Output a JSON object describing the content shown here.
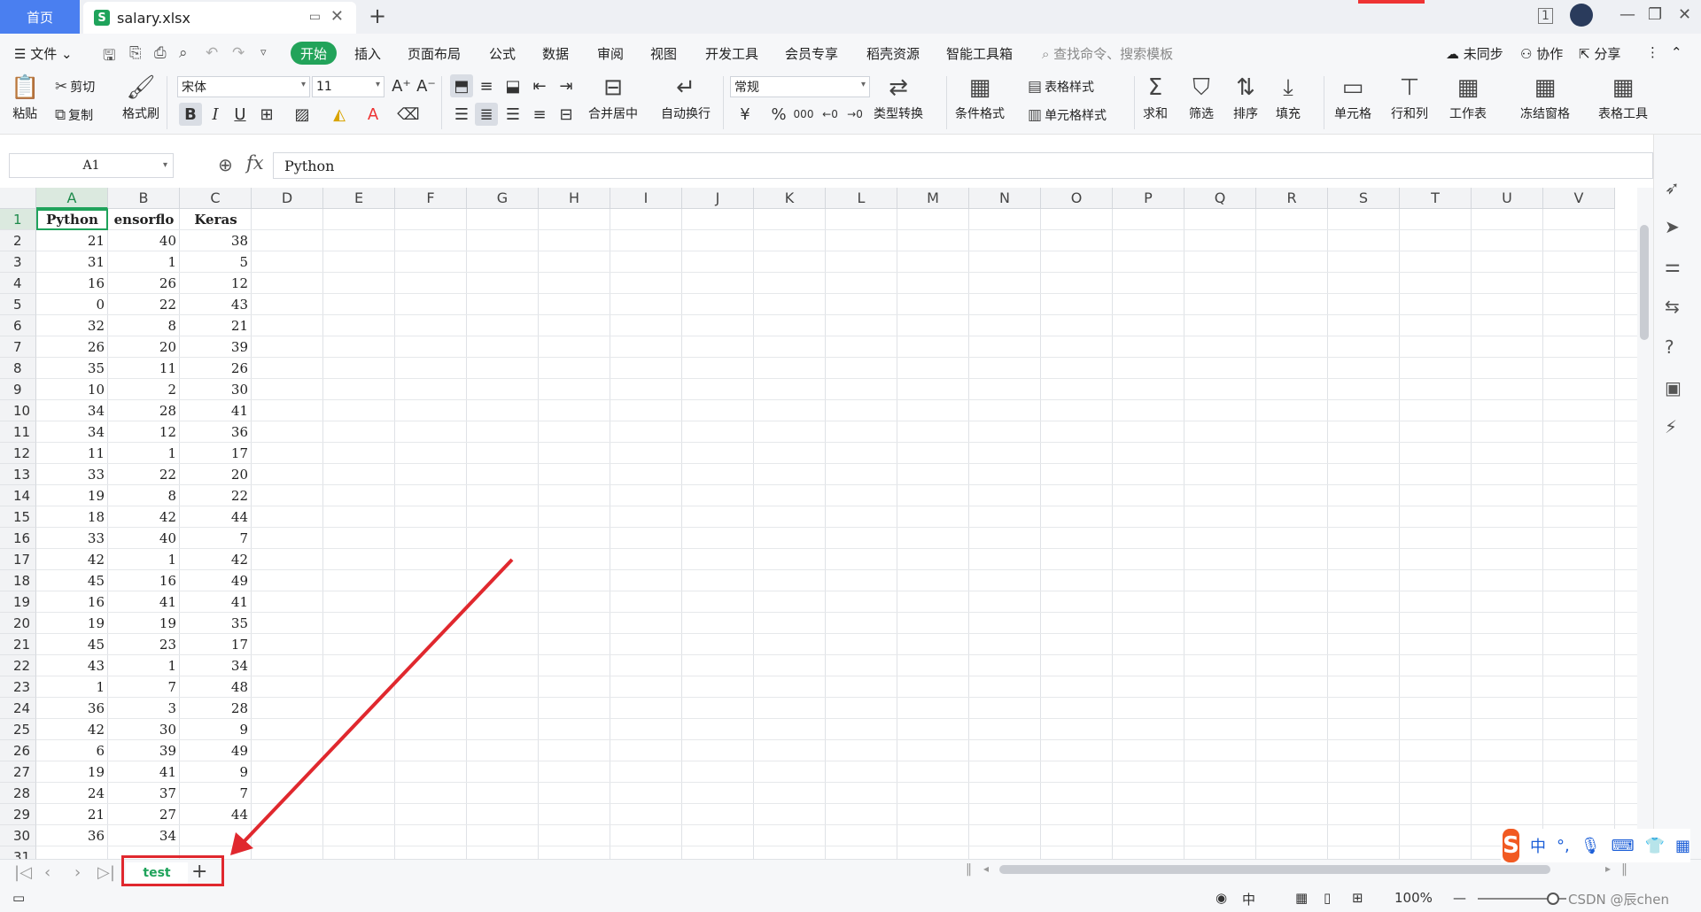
{
  "titlebar": {
    "home_tab": "首页",
    "file_tab": "salary.xlsx",
    "file_icon": "S",
    "account_badge": "1"
  },
  "menu": {
    "file": "文件",
    "items": [
      "开始",
      "插入",
      "页面布局",
      "公式",
      "数据",
      "审阅",
      "视图",
      "开发工具",
      "会员专享",
      "稻壳资源",
      "智能工具箱"
    ],
    "search_placeholder": "查找命令、搜索模板",
    "sync": "未同步",
    "collab": "协作",
    "share": "分享"
  },
  "ribbon": {
    "paste": "粘贴",
    "cut": "剪切",
    "copy": "复制",
    "format_painter": "格式刷",
    "font_name": "宋体",
    "font_size": "11",
    "merge_center": "合并居中",
    "wrap_text": "自动换行",
    "number_format": "常规",
    "type_convert": "类型转换",
    "conditional_format": "条件格式",
    "table_style": "表格样式",
    "cell_style": "单元格样式",
    "sum": "求和",
    "filter": "筛选",
    "sort": "排序",
    "fill": "填充",
    "cell": "单元格",
    "row_col": "行和列",
    "worksheet": "工作表",
    "freeze": "冻结窗格",
    "table_tools": "表格工具",
    "currency": "¥",
    "percent": "%",
    "thousands": "000"
  },
  "formula_bar": {
    "name_box": "A1",
    "fx": "fx",
    "value": "Python"
  },
  "grid": {
    "columns": [
      "A",
      "B",
      "C",
      "D",
      "E",
      "F",
      "G",
      "H",
      "I",
      "J",
      "K",
      "L",
      "M",
      "N",
      "O",
      "P",
      "Q",
      "R",
      "S",
      "T",
      "U",
      "V"
    ],
    "headers": [
      "Python",
      "ensorflo",
      "Keras"
    ],
    "rows": [
      [
        21,
        40,
        38
      ],
      [
        31,
        1,
        5
      ],
      [
        16,
        26,
        12
      ],
      [
        0,
        22,
        43
      ],
      [
        32,
        8,
        21
      ],
      [
        26,
        20,
        39
      ],
      [
        35,
        11,
        26
      ],
      [
        10,
        2,
        30
      ],
      [
        34,
        28,
        41
      ],
      [
        34,
        12,
        36
      ],
      [
        11,
        1,
        17
      ],
      [
        33,
        22,
        20
      ],
      [
        19,
        8,
        22
      ],
      [
        18,
        42,
        44
      ],
      [
        33,
        40,
        7
      ],
      [
        42,
        1,
        42
      ],
      [
        45,
        16,
        49
      ],
      [
        16,
        41,
        41
      ],
      [
        19,
        19,
        35
      ],
      [
        45,
        23,
        17
      ],
      [
        43,
        1,
        34
      ],
      [
        1,
        7,
        48
      ],
      [
        36,
        3,
        28
      ],
      [
        42,
        30,
        9
      ],
      [
        6,
        39,
        49
      ],
      [
        19,
        41,
        9
      ],
      [
        24,
        37,
        7
      ],
      [
        21,
        27,
        44
      ],
      [
        36,
        34,
        ""
      ]
    ],
    "partial_row_number": "31"
  },
  "sheets": {
    "active": "test",
    "add": "+"
  },
  "status": {
    "zoom": "100%",
    "watermark": "CSDN @辰chen"
  },
  "ime": {
    "logo": "S",
    "mode": "中"
  }
}
